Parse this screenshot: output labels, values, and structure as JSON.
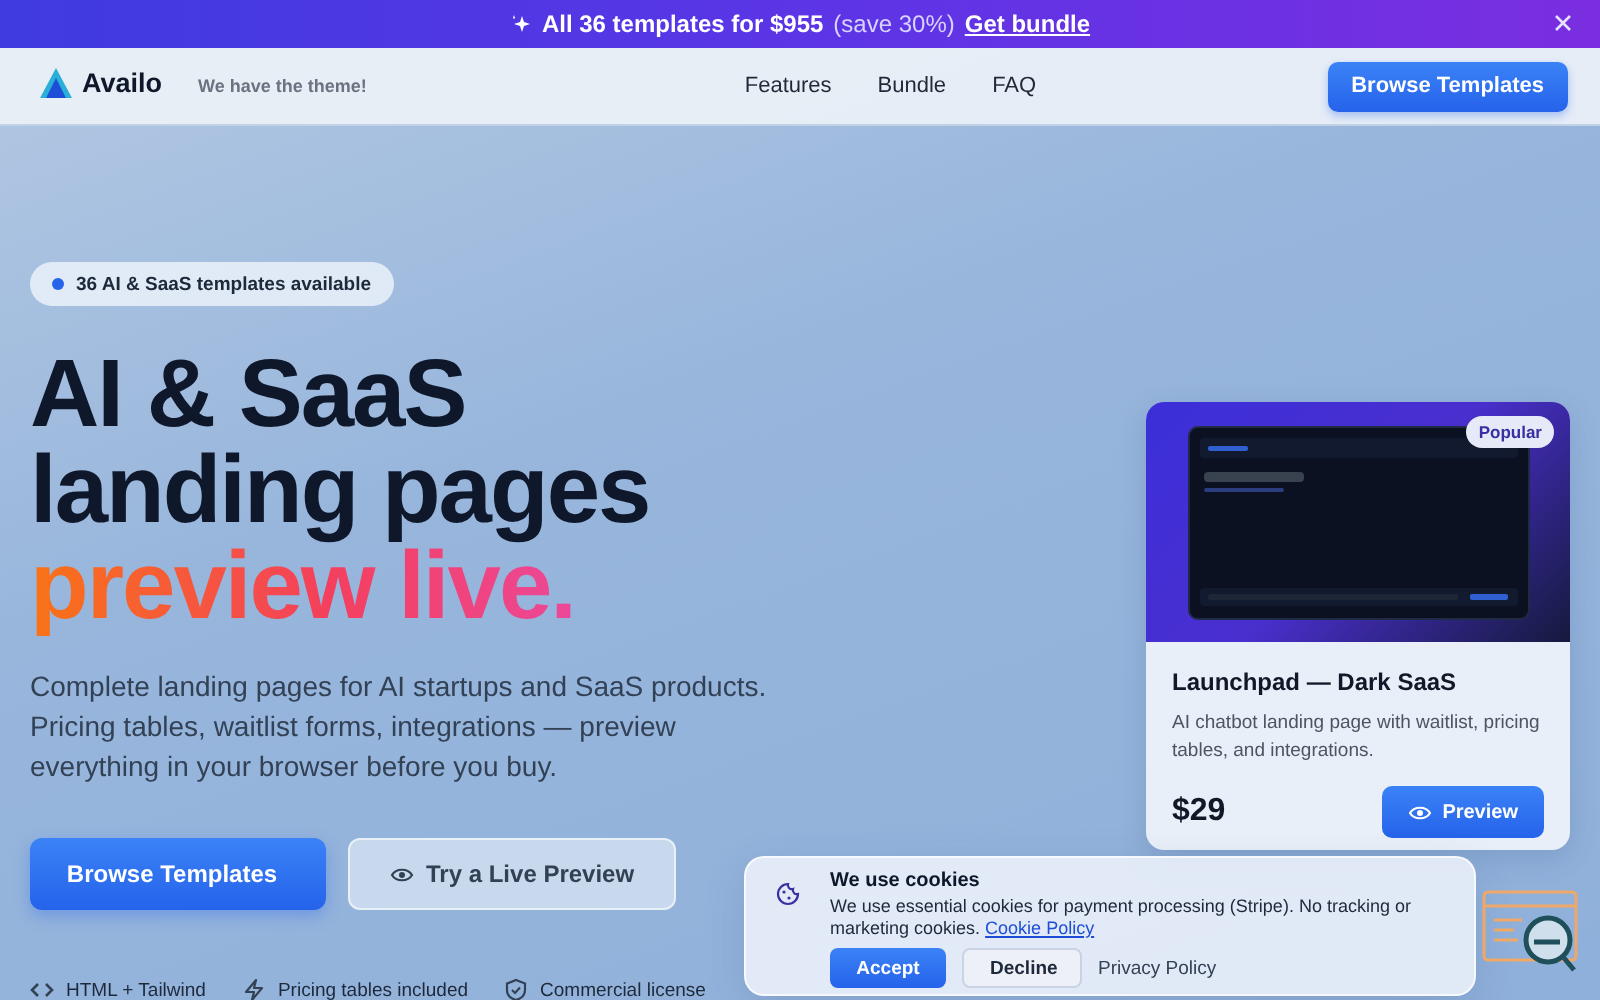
{
  "announcement": {
    "text": "All 36 templates for $955",
    "note": "(save 30%)",
    "link": "Get bundle"
  },
  "nav": {
    "brand": "Availo",
    "tagline": "We have the theme!",
    "links": [
      "Features",
      "Bundle",
      "FAQ"
    ],
    "cta": "Browse Templates"
  },
  "hero": {
    "badge": "36 AI & SaaS templates available",
    "headline": [
      "AI & SaaS",
      "landing pages"
    ],
    "highlight": "preview live.",
    "description": "Complete landing pages for AI startups and SaaS products. Pricing tables, waitlist forms, integrations — preview everything in your browser before you buy.",
    "buttons": [
      {
        "label": "Browse Templates",
        "kind": "primary"
      },
      {
        "label": "Try a Live Preview",
        "kind": "secondary"
      }
    ],
    "features": [
      {
        "label": "HTML + Tailwind",
        "kind": "code"
      },
      {
        "label": "Pricing tables included",
        "kind": "bolt"
      },
      {
        "label": "Commercial license",
        "kind": "shield"
      }
    ]
  },
  "card": {
    "badge": "Popular",
    "title": "Launchpad — Dark SaaS",
    "description": "AI chatbot landing page with waitlist, pricing tables, and integrations.",
    "price": "$29",
    "button": "Preview"
  },
  "cookie_banner": {
    "title": "We use cookies",
    "text": "We use essential cookies for payment processing (Stripe). No tracking or marketing cookies.",
    "link": "Cookie Policy",
    "buttons": [
      {
        "label": "Accept",
        "kind": "primary"
      },
      {
        "label": "Decline",
        "kind": "secondary"
      }
    ],
    "secondary_link": "Privacy Policy"
  }
}
